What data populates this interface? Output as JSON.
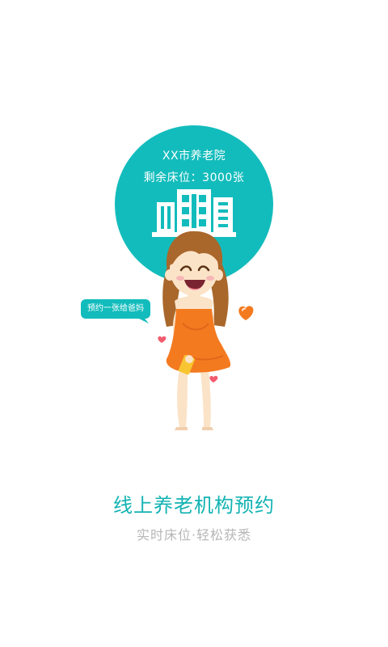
{
  "circle": {
    "facility_name": "XX市养老院",
    "beds_text": "剩余床位：3000张"
  },
  "bubble": {
    "text": "预约一张给爸妈"
  },
  "slogan": {
    "title": "线上养老机构预约",
    "subtitle": "实时床位·轻松获悉"
  },
  "colors": {
    "accent": "#13bcbc",
    "dress": "#f47a20",
    "hair": "#a9672b",
    "heart": "#f25b6e",
    "subtitle": "#b6b6b6"
  },
  "icons": [
    "building-icon",
    "heart-icon",
    "speech-bubble-icon"
  ]
}
